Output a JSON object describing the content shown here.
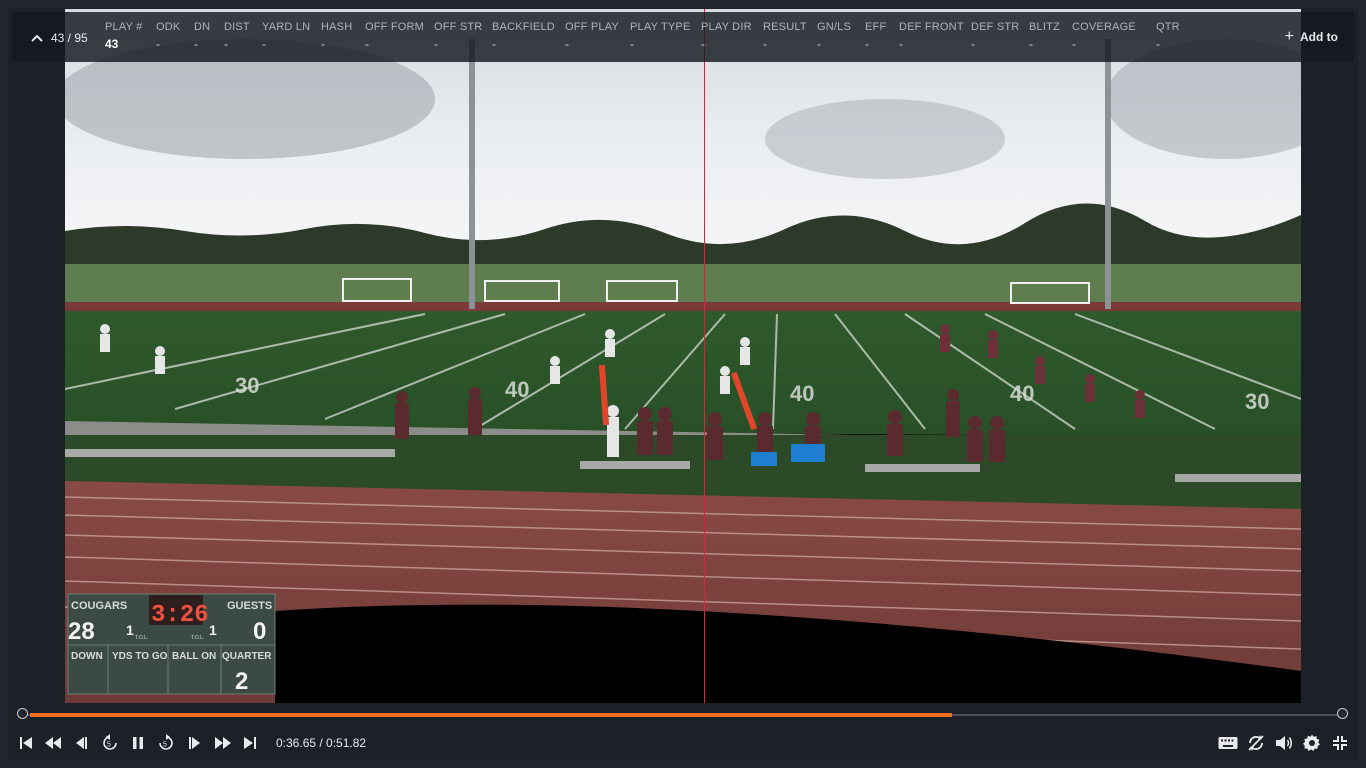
{
  "header": {
    "counter": "43 / 95",
    "add_label": "Add to",
    "columns": [
      {
        "label": "PLAY #",
        "value": "43"
      },
      {
        "label": "ODK",
        "value": "-"
      },
      {
        "label": "DN",
        "value": "-"
      },
      {
        "label": "DIST",
        "value": "-"
      },
      {
        "label": "YARD LN",
        "value": "-"
      },
      {
        "label": "HASH",
        "value": "-"
      },
      {
        "label": "OFF FORM",
        "value": "-"
      },
      {
        "label": "OFF STR",
        "value": "-"
      },
      {
        "label": "BACKFIELD",
        "value": "-"
      },
      {
        "label": "OFF PLAY",
        "value": "-"
      },
      {
        "label": "PLAY TYPE",
        "value": "-"
      },
      {
        "label": "PLAY DIR",
        "value": "-"
      },
      {
        "label": "RESULT",
        "value": "-"
      },
      {
        "label": "GN/LS",
        "value": "-"
      },
      {
        "label": "EFF",
        "value": "-"
      },
      {
        "label": "DEF FRONT",
        "value": "-"
      },
      {
        "label": "DEF STR",
        "value": "-"
      },
      {
        "label": "BLITZ",
        "value": "-"
      },
      {
        "label": "COVERAGE",
        "value": "-"
      },
      {
        "label": "QTR",
        "value": "-"
      }
    ]
  },
  "scoreboard": {
    "home_label": "COUGARS",
    "guest_label": "GUESTS",
    "clock": "3:26",
    "home_score": "28",
    "guest_score": "0",
    "home_tol": "1",
    "guest_tol": "1",
    "tol_label": "T.O.L.",
    "down_label": "DOWN",
    "ytg_label": "YDS TO GO",
    "ball_on_label": "BALL ON",
    "quarter_label": "QUARTER",
    "quarter": "2"
  },
  "field": {
    "yard_numbers": [
      "40",
      "30",
      "40",
      "40",
      "30"
    ]
  },
  "player": {
    "current_time": "0:36.65",
    "total_time": "0:51.82",
    "time_display": "0:36.65 / 0:51.82",
    "progress": 0.7068,
    "accent_color": "#f26c1a",
    "playhead_color": "#e0213a"
  },
  "controls": {
    "left": [
      "skip-to-start-icon",
      "rewind-icon",
      "step-back-icon",
      "replay-5-icon",
      "pause-icon",
      "forward-5-icon",
      "step-forward-icon",
      "fast-forward-icon",
      "skip-to-end-icon"
    ],
    "right": [
      "keyboard-icon",
      "loop-off-icon",
      "volume-icon",
      "settings-icon",
      "exit-fullscreen-icon"
    ]
  }
}
